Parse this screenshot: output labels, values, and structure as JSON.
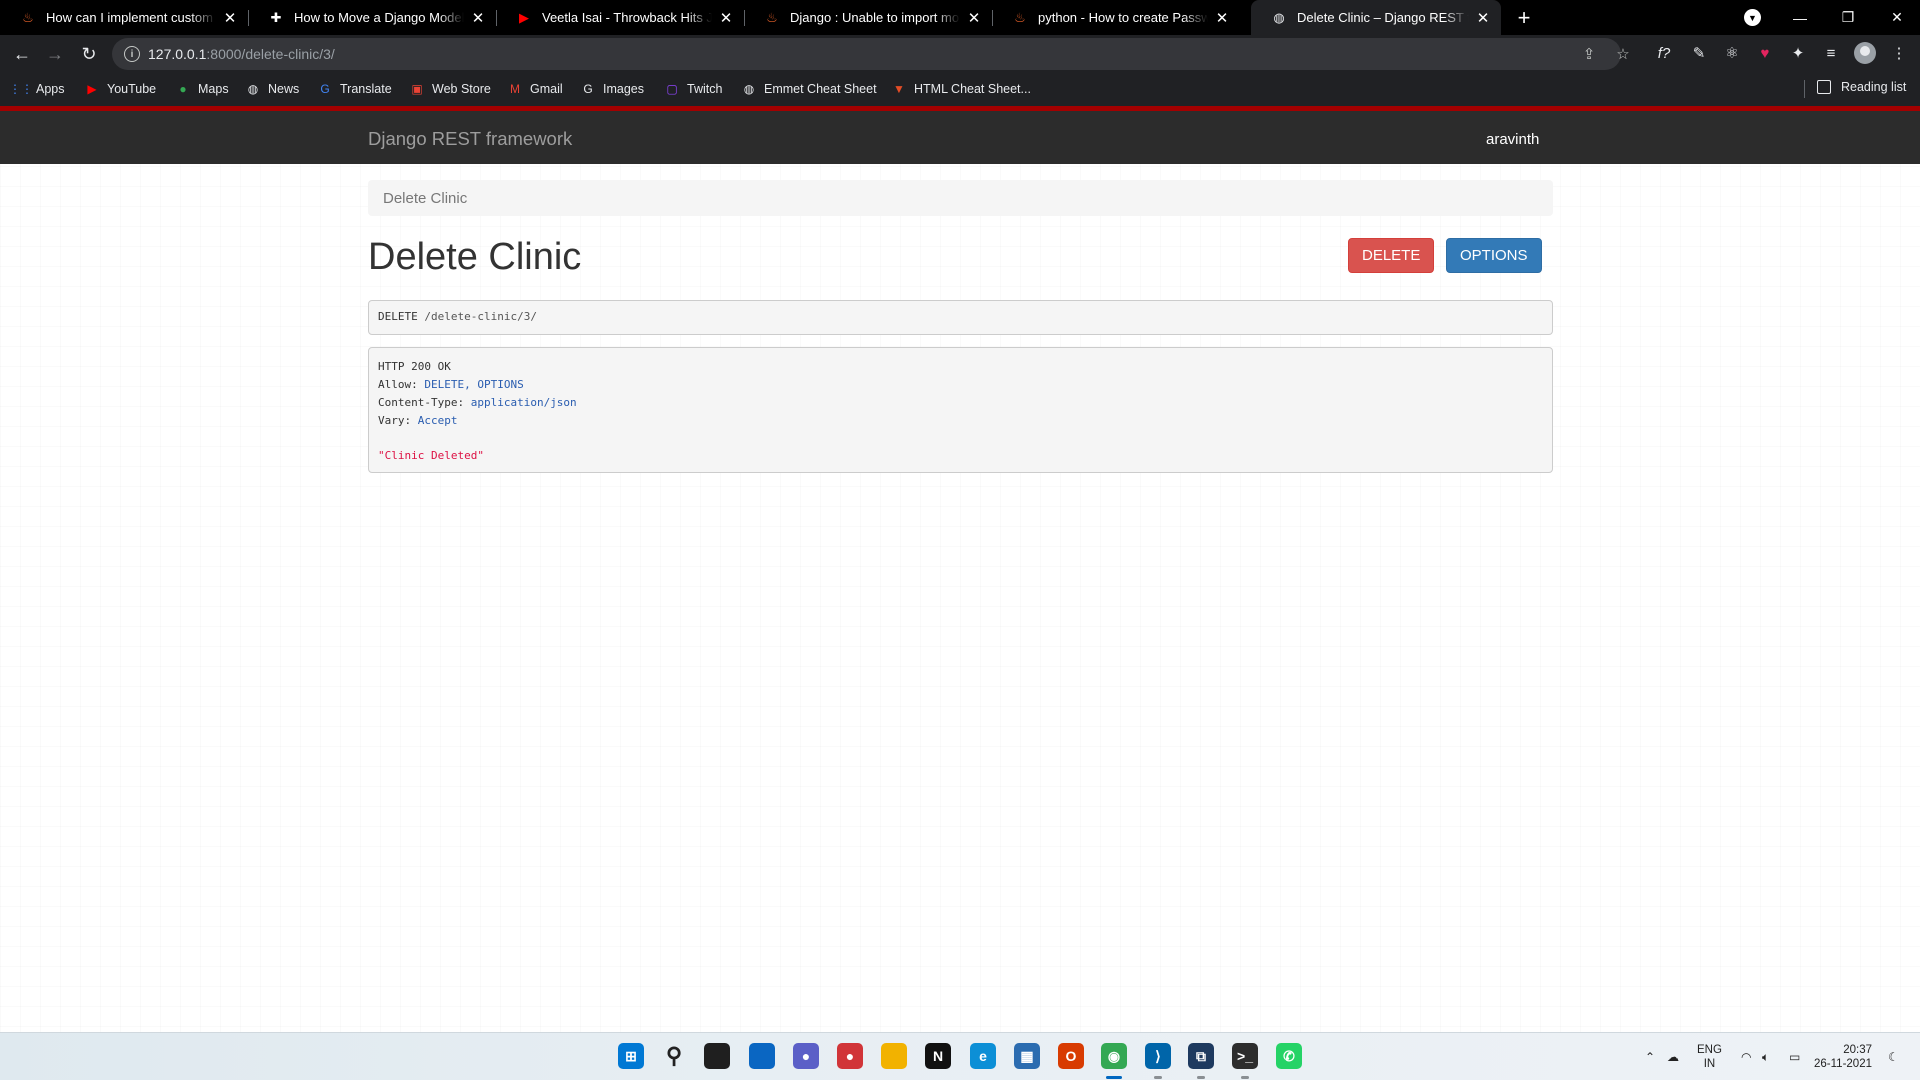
{
  "browser": {
    "tabs": [
      {
        "title": "How can I implement custom user",
        "favicon": "django-icon",
        "glyph": "♨",
        "color": "#e8622a",
        "active": false
      },
      {
        "title": "How to Move a Django Model to",
        "favicon": "stackedit-icon",
        "glyph": "✚",
        "color": "#ffffff",
        "active": false
      },
      {
        "title": "Veetla Isai - Throwback Hits Jukebox",
        "favicon": "youtube-icon",
        "glyph": "▶",
        "color": "#ff0000",
        "active": false
      },
      {
        "title": "Django : Unable to import model",
        "favicon": "stackoverflow-icon",
        "glyph": "♨",
        "color": "#e8622a",
        "active": false
      },
      {
        "title": "python - How to create Password",
        "favicon": "stackoverflow-icon",
        "glyph": "♨",
        "color": "#e8622a",
        "active": false
      },
      {
        "title": "Delete Clinic – Django REST framework",
        "favicon": "globe-icon",
        "glyph": "◍",
        "color": "#e8eaed",
        "active": true
      }
    ],
    "url_host": "127.0.0.1",
    "url_rest": ":8000/delete-clinic/3/",
    "bookmarks": [
      {
        "label": "Apps",
        "icon": "apps-grid-icon",
        "glyph": "⋮⋮",
        "color": "#4285f4"
      },
      {
        "label": "YouTube",
        "icon": "youtube-icon",
        "glyph": "▶",
        "color": "#ff0000"
      },
      {
        "label": "Maps",
        "icon": "maps-pin-icon",
        "glyph": "●",
        "color": "#34a853"
      },
      {
        "label": "News",
        "icon": "news-globe-icon",
        "glyph": "◍",
        "color": "#e8eaed"
      },
      {
        "label": "Translate",
        "icon": "translate-icon",
        "glyph": "G",
        "color": "#4285f4"
      },
      {
        "label": "Web Store",
        "icon": "webstore-icon",
        "glyph": "▣",
        "color": "#ea4335"
      },
      {
        "label": "Gmail",
        "icon": "gmail-icon",
        "glyph": "M",
        "color": "#ea4335"
      },
      {
        "label": "Images",
        "icon": "google-icon",
        "glyph": "G",
        "color": "#e8eaed"
      },
      {
        "label": "Twitch",
        "icon": "twitch-icon",
        "glyph": "▢",
        "color": "#9146ff"
      },
      {
        "label": "Emmet Cheat Sheet",
        "icon": "globe-icon",
        "glyph": "◍",
        "color": "#e8eaed"
      },
      {
        "label": "HTML Cheat Sheet...",
        "icon": "html5-icon",
        "glyph": "▼",
        "color": "#e44d26"
      }
    ],
    "reading_list": "Reading list"
  },
  "page": {
    "brand": "Django REST framework",
    "user": "aravinth",
    "breadcrumb": "Delete Clinic",
    "title": "Delete Clinic",
    "buttons": {
      "delete": "DELETE",
      "options": "OPTIONS"
    },
    "request": {
      "method": "DELETE",
      "path": "/delete-clinic/3/"
    },
    "response": {
      "status": "HTTP 200 OK",
      "headers": [
        {
          "name": "Allow:",
          "value": "DELETE, OPTIONS"
        },
        {
          "name": "Content-Type:",
          "value": "application/json"
        },
        {
          "name": "Vary:",
          "value": "Accept"
        }
      ],
      "body": "\"Clinic Deleted\""
    }
  },
  "taskbar": {
    "apps": [
      {
        "name": "windows-start-icon",
        "color": "#0078d4",
        "glyph": "⊞"
      },
      {
        "name": "search-icon",
        "color": "transparent",
        "glyph": "⚲"
      },
      {
        "name": "task-view-icon",
        "color": "#1f1f1f",
        "glyph": ""
      },
      {
        "name": "widgets-icon",
        "color": "#0a66c2",
        "glyph": ""
      },
      {
        "name": "teams-chat-icon",
        "color": "#5b5fc7",
        "glyph": "●"
      },
      {
        "name": "recorder-icon",
        "color": "#d13438",
        "glyph": "●"
      },
      {
        "name": "file-explorer-icon",
        "color": "#f2b200",
        "glyph": ""
      },
      {
        "name": "notion-icon",
        "color": "#111111",
        "glyph": "N"
      },
      {
        "name": "edge-icon",
        "color": "#0c8fd6",
        "glyph": "e"
      },
      {
        "name": "store-icon",
        "color": "#2b6cb0",
        "glyph": "▦"
      },
      {
        "name": "office-icon",
        "color": "#d83b01",
        "glyph": "O"
      },
      {
        "name": "chrome-icon",
        "color": "#34a853",
        "glyph": "◉"
      },
      {
        "name": "vscode-icon",
        "color": "#0065a9",
        "glyph": "⟩"
      },
      {
        "name": "code-editor-icon",
        "color": "#1e3a5f",
        "glyph": "⧉"
      },
      {
        "name": "terminal-icon",
        "color": "#2d2d2d",
        "glyph": ">_"
      },
      {
        "name": "whatsapp-icon",
        "color": "#25d366",
        "glyph": "✆"
      }
    ],
    "lang_top": "ENG",
    "lang_bottom": "IN",
    "time": "20:37",
    "date": "26-11-2021"
  }
}
